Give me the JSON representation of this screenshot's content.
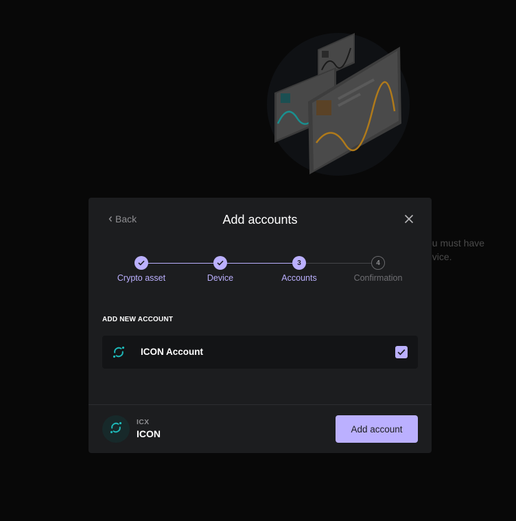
{
  "background": {
    "text_lines": [
      "ou must have",
      "evice."
    ]
  },
  "modal": {
    "back_label": "Back",
    "title": "Add accounts",
    "steps": [
      {
        "number": "1",
        "label": "Crypto asset",
        "state": "done"
      },
      {
        "number": "2",
        "label": "Device",
        "state": "done"
      },
      {
        "number": "3",
        "label": "Accounts",
        "state": "active"
      },
      {
        "number": "4",
        "label": "Confirmation",
        "state": "todo"
      }
    ],
    "section_label": "ADD NEW ACCOUNT",
    "accounts": [
      {
        "name": "ICON Account",
        "checked": true,
        "icon": "icon-network-icon"
      }
    ],
    "footer": {
      "ticker": "ICX",
      "currency_name": "ICON",
      "add_button_label": "Add account"
    }
  },
  "colors": {
    "accent": "#bbb0ff",
    "icon_teal": "#1eb8b8",
    "modal_bg": "#1c1d1f",
    "page_bg": "#080808"
  }
}
